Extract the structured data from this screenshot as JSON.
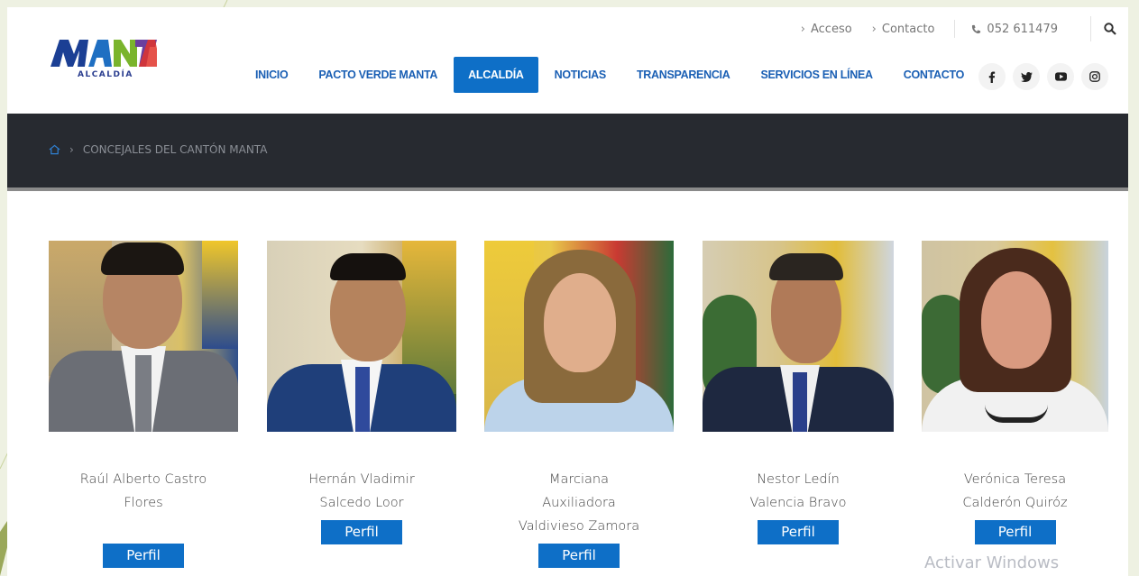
{
  "logo": {
    "text": "MANTA",
    "subtitle": "ALCALDÍA"
  },
  "topbar": {
    "acceso": "Acceso",
    "contacto": "Contacto",
    "phone": "052 611479"
  },
  "nav": [
    {
      "label": "INICIO"
    },
    {
      "label": "PACTO VERDE MANTA"
    },
    {
      "label": "ALCALDÍA",
      "active": true
    },
    {
      "label": "NOTICIAS"
    },
    {
      "label": "TRANSPARENCIA"
    },
    {
      "label": "SERVICIOS EN LÍNEA"
    },
    {
      "label": "CONTACTO"
    }
  ],
  "social": [
    "facebook-icon",
    "twitter-icon",
    "youtube-icon",
    "instagram-icon"
  ],
  "breadcrumb": {
    "current": "CONCEJALES DEL CANTÓN MANTA"
  },
  "councilors": [
    {
      "line1": "Raúl Alberto Castro",
      "line2": "Flores",
      "line3": "",
      "button": "Perfil"
    },
    {
      "line1": "Hernán Vladimir",
      "line2": "Salcedo Loor",
      "line3": "",
      "button": "Perfil"
    },
    {
      "line1": "Marciana",
      "line2": "Auxiliadora",
      "line3": "Valdivieso Zamora",
      "button": "Perfil"
    },
    {
      "line1": "Nestor Ledín",
      "line2": "Valencia Bravo",
      "line3": "",
      "button": "Perfil"
    },
    {
      "line1": "Verónica Teresa",
      "line2": "Calderón Quiróz",
      "line3": "",
      "button": "Perfil"
    }
  ],
  "watermark": "Activar Windows",
  "colors": {
    "brand_blue": "#0e6fc7",
    "nav_text": "#1a5fb4",
    "band": "#272a30"
  }
}
